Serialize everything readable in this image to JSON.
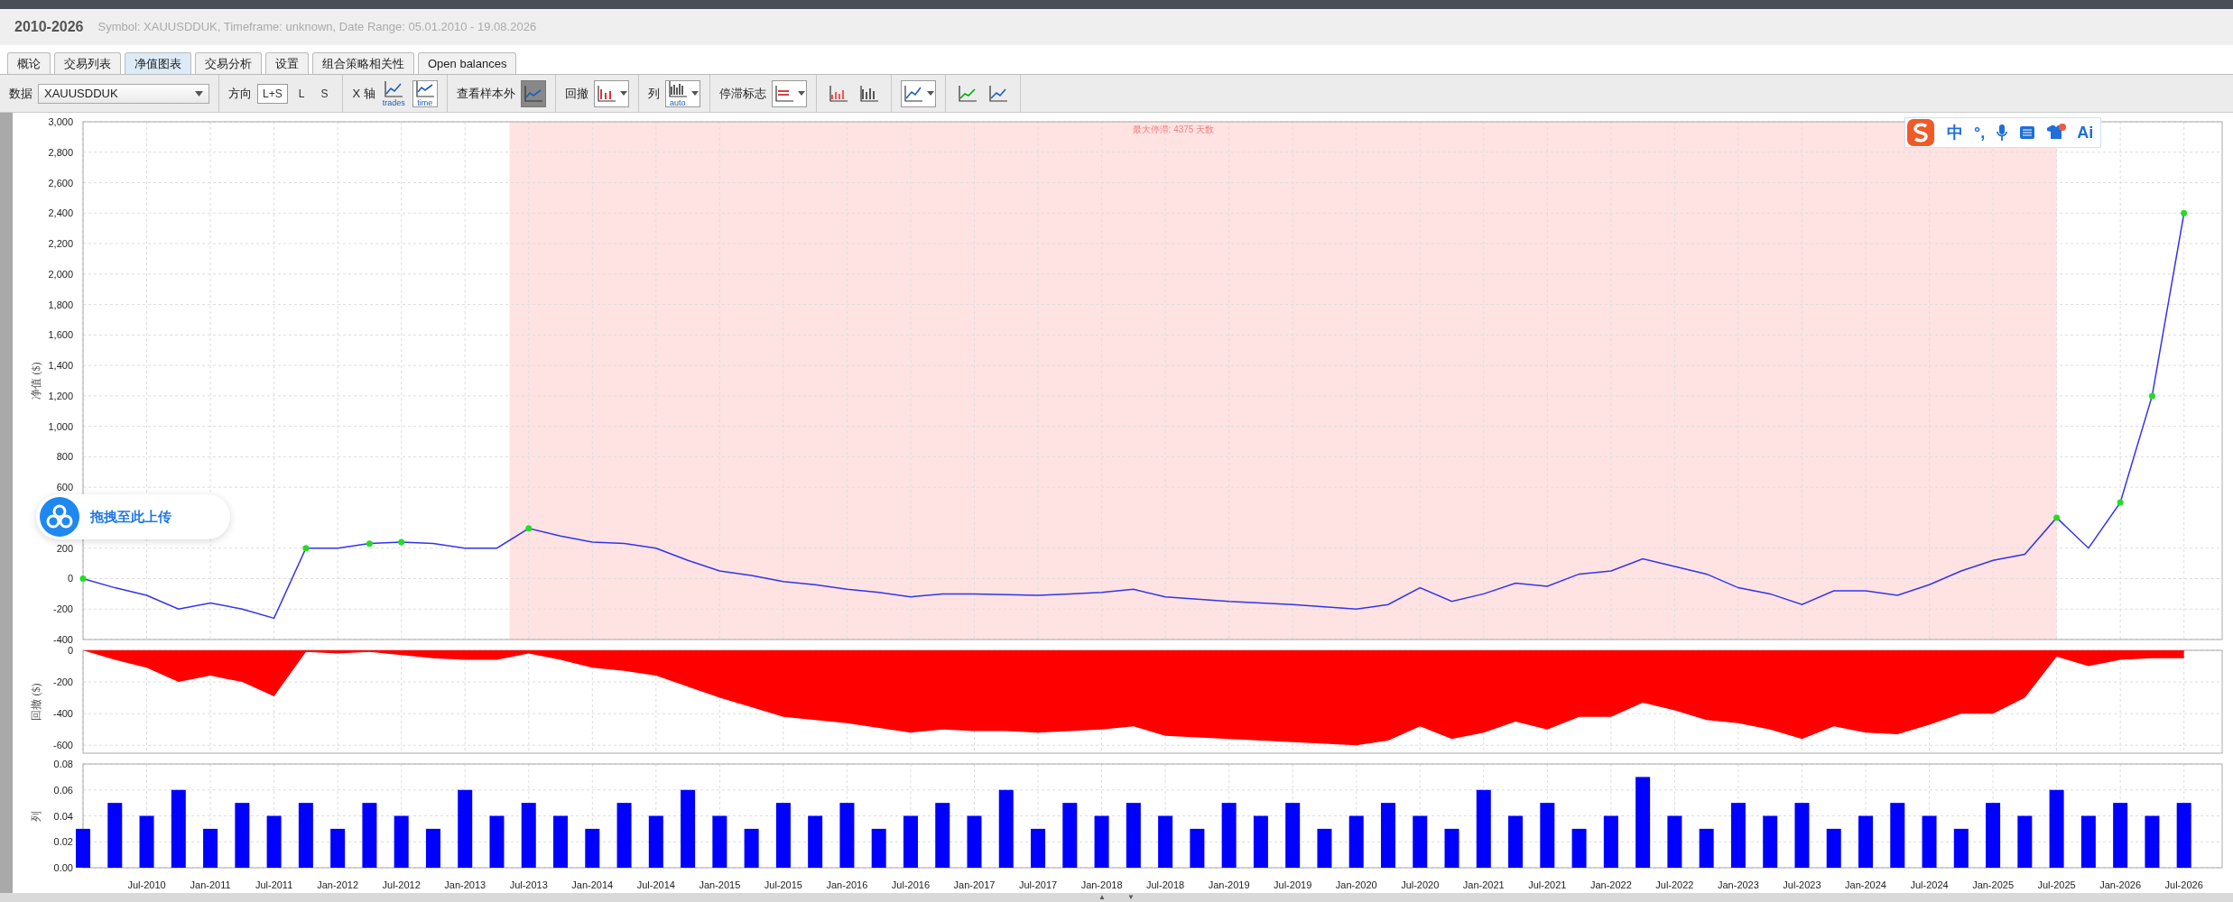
{
  "header": {
    "title": "2010-2026",
    "subtitle": "Symbol: XAUUSDDUK, Timeframe: unknown, Date Range: 05.01.2010 - 19.08.2026"
  },
  "tabs": [
    {
      "label": "概论",
      "selected": false
    },
    {
      "label": "交易列表",
      "selected": false
    },
    {
      "label": "净值图表",
      "selected": true
    },
    {
      "label": "交易分析",
      "selected": false
    },
    {
      "label": "设置",
      "selected": false
    },
    {
      "label": "组合策略相关性",
      "selected": false
    },
    {
      "label": "Open balances",
      "selected": false
    }
  ],
  "toolbar_groups": [
    [
      {
        "kind": "label",
        "text": "数据"
      },
      {
        "kind": "select",
        "value": "XAUUSDDUK"
      }
    ],
    [
      {
        "kind": "label",
        "text": "方向"
      },
      {
        "kind": "toggle",
        "text": "L+S",
        "selected": true
      },
      {
        "kind": "toggle",
        "text": "L",
        "selected": false
      },
      {
        "kind": "toggle",
        "text": "S",
        "selected": false
      }
    ],
    [
      {
        "kind": "label",
        "text": "X 轴"
      },
      {
        "kind": "icon",
        "caption": "trades",
        "selected": false,
        "disabled": false,
        "dropdown": false
      },
      {
        "kind": "icon",
        "caption": "time",
        "selected": true,
        "disabled": false,
        "dropdown": false
      }
    ],
    [
      {
        "kind": "label",
        "text": "查看样本外"
      },
      {
        "kind": "icon",
        "selected": false,
        "disabled": true,
        "dropdown": false
      }
    ],
    [
      {
        "kind": "label",
        "text": "回撤"
      },
      {
        "kind": "icon",
        "selected": true,
        "disabled": false,
        "dropdown": true
      }
    ],
    [
      {
        "kind": "label",
        "text": "列"
      },
      {
        "kind": "icon",
        "caption": "auto",
        "selected": true,
        "disabled": false,
        "dropdown": true
      }
    ],
    [
      {
        "kind": "label",
        "text": "停滞标志"
      },
      {
        "kind": "icon",
        "selected": true,
        "disabled": false,
        "dropdown": true
      }
    ],
    [
      {
        "kind": "icon",
        "selected": false,
        "disabled": false,
        "dropdown": false
      },
      {
        "kind": "icon",
        "selected": false,
        "disabled": false,
        "dropdown": false
      }
    ],
    [
      {
        "kind": "icon",
        "selected": true,
        "disabled": false,
        "dropdown": true
      }
    ],
    [
      {
        "kind": "icon",
        "selected": false,
        "disabled": false,
        "dropdown": false
      },
      {
        "kind": "icon",
        "selected": false,
        "disabled": false,
        "dropdown": false
      }
    ]
  ],
  "equity_chart": {
    "chart_data": {
      "type": "line",
      "ylabel": "净值 ($)",
      "ylim": [
        -400,
        3000
      ],
      "yticks": [
        {
          "value": -400,
          "label": "-400"
        },
        {
          "value": -200,
          "label": "-200"
        },
        {
          "value": 0,
          "label": "0"
        },
        {
          "value": 200,
          "label": "200"
        },
        {
          "value": 600,
          "label": "600"
        },
        {
          "value": 800,
          "label": "800"
        },
        {
          "value": 1000,
          "label": "1,000"
        },
        {
          "value": 1200,
          "label": "1,200"
        },
        {
          "value": 1400,
          "label": "1,400"
        },
        {
          "value": 1600,
          "label": "1,600"
        },
        {
          "value": 1800,
          "label": "1,800"
        },
        {
          "value": 2000,
          "label": "2,000"
        },
        {
          "value": 2200,
          "label": "2,200"
        },
        {
          "value": 2400,
          "label": "2,400"
        },
        {
          "value": 2600,
          "label": "2,600"
        },
        {
          "value": 2800,
          "label": "2,800"
        },
        {
          "value": 3000,
          "label": "3,000"
        }
      ],
      "categories": [
        null,
        null,
        null,
        null,
        null,
        null,
        null,
        null,
        null,
        null,
        null,
        null,
        null,
        null,
        null,
        null,
        null,
        null,
        null,
        null,
        null,
        null,
        null,
        null,
        null,
        null,
        null,
        null,
        null,
        null,
        null,
        null,
        null,
        null,
        null,
        null,
        null,
        null,
        null,
        null,
        null,
        null,
        null,
        null,
        null,
        null,
        null,
        null,
        null,
        null,
        null,
        null,
        null,
        null,
        null,
        null,
        null,
        null,
        null,
        null,
        null,
        null,
        null,
        null,
        null,
        null,
        null
      ],
      "series": [
        {
          "color": "#3333ee",
          "values": [
            0,
            -60,
            -110,
            -200,
            -160,
            -200,
            -260,
            200,
            200,
            230,
            240,
            230,
            200,
            200,
            330,
            280,
            240,
            230,
            200,
            120,
            50,
            20,
            -20,
            -40,
            -70,
            -90,
            -120,
            -100,
            -100,
            -105,
            -110,
            -100,
            -90,
            -70,
            -120,
            -135,
            -150,
            -160,
            -170,
            -185,
            -200,
            -170,
            -60,
            -150,
            -100,
            -30,
            -50,
            30,
            50,
            130,
            80,
            30,
            -60,
            -100,
            -170,
            -80,
            -80,
            -110,
            -40,
            50,
            120,
            160,
            400,
            200,
            500,
            1200,
            2400
          ]
        }
      ],
      "grid": true
    },
    "stagnation_band": {
      "label": "最大停滞: 4375 天数"
    }
  },
  "drawdown_chart": {
    "chart_data": {
      "type": "area",
      "ylabel": "回撤 ($)",
      "ylim": [
        -650,
        0
      ],
      "yticks": [
        {
          "value": 0,
          "label": "0"
        },
        {
          "value": -200,
          "label": "-200"
        },
        {
          "value": -400,
          "label": "-400"
        },
        {
          "value": -600,
          "label": "-600"
        }
      ],
      "categories": [
        null,
        null,
        null,
        null,
        null,
        null,
        null,
        null,
        null,
        null,
        null,
        null,
        null,
        null,
        null,
        null,
        null,
        null,
        null,
        null,
        null,
        null,
        null,
        null,
        null,
        null,
        null,
        null,
        null,
        null,
        null,
        null,
        null,
        null,
        null,
        null,
        null,
        null,
        null,
        null,
        null,
        null,
        null,
        null,
        null,
        null,
        null,
        null,
        null,
        null,
        null,
        null,
        null,
        null,
        null,
        null,
        null,
        null,
        null,
        null,
        null,
        null,
        null,
        null,
        null,
        null,
        null
      ],
      "grid": true,
      "series": [
        {
          "color": "#ff0000",
          "values": [
            0,
            -60,
            -110,
            -200,
            -160,
            -200,
            -290,
            -10,
            -20,
            -10,
            -30,
            -50,
            -60,
            -60,
            -20,
            -60,
            -110,
            -130,
            -160,
            -230,
            -300,
            -360,
            -420,
            -440,
            -460,
            -490,
            -520,
            -500,
            -510,
            -510,
            -520,
            -510,
            -500,
            -480,
            -540,
            -550,
            -560,
            -570,
            -580,
            -590,
            -600,
            -570,
            -480,
            -560,
            -520,
            -450,
            -500,
            -420,
            -420,
            -330,
            -380,
            -440,
            -460,
            -500,
            -560,
            -480,
            -520,
            -530,
            -470,
            -400,
            -400,
            -300,
            -40,
            -100,
            -60,
            -50,
            -50
          ]
        }
      ]
    }
  },
  "lots_chart": {
    "chart_data": {
      "type": "bar",
      "ylabel": "列",
      "ylim": [
        0,
        0.08
      ],
      "grid": true,
      "categories": [
        null,
        null,
        "Jul-2010",
        null,
        "Jan-2011",
        null,
        "Jul-2011",
        null,
        "Jan-2012",
        null,
        "Jul-2012",
        null,
        "Jan-2013",
        null,
        "Jul-2013",
        null,
        "Jan-2014",
        null,
        "Jul-2014",
        null,
        "Jan-2015",
        null,
        "Jul-2015",
        null,
        "Jan-2016",
        null,
        "Jul-2016",
        null,
        "Jan-2017",
        null,
        "Jul-2017",
        null,
        "Jan-2018",
        null,
        "Jul-2018",
        null,
        "Jan-2019",
        null,
        "Jul-2019",
        null,
        "Jan-2020",
        null,
        "Jul-2020",
        null,
        "Jan-2021",
        null,
        "Jul-2021",
        null,
        "Jan-2022",
        null,
        "Jul-2022",
        null,
        "Jan-2023",
        null,
        "Jul-2023",
        null,
        "Jan-2024",
        null,
        "Jul-2024",
        null,
        "Jan-2025",
        null,
        "Jul-2025",
        null,
        "Jan-2026",
        null,
        "Jul-2026"
      ],
      "yticks": [
        {
          "value": 0,
          "label": "0.00"
        },
        {
          "value": 0.02,
          "label": "0.02"
        },
        {
          "value": 0.04,
          "label": "0.04"
        },
        {
          "value": 0.06,
          "label": "0.06"
        },
        {
          "value": 0.08,
          "label": "0.08"
        }
      ],
      "series": [
        {
          "color": "#0000ff",
          "values": [
            0.03,
            0.05,
            0.04,
            0.06,
            0.03,
            0.05,
            0.04,
            0.05,
            0.03,
            0.05,
            0.04,
            0.03,
            0.06,
            0.04,
            0.05,
            0.04,
            0.03,
            0.05,
            0.04,
            0.06,
            0.04,
            0.03,
            0.05,
            0.04,
            0.05,
            0.03,
            0.04,
            0.05,
            0.04,
            0.06,
            0.03,
            0.05,
            0.04,
            0.05,
            0.04,
            0.03,
            0.05,
            0.04,
            0.05,
            0.03,
            0.04,
            0.05,
            0.04,
            0.03,
            0.06,
            0.04,
            0.05,
            0.03,
            0.04,
            0.07,
            0.04,
            0.03,
            0.05,
            0.04,
            0.05,
            0.03,
            0.04,
            0.05,
            0.04,
            0.03,
            0.05,
            0.04,
            0.06,
            0.04,
            0.05,
            0.04,
            0.05
          ]
        }
      ]
    }
  },
  "overlays": {
    "ime_toolbar": {
      "items": [
        "中",
        "°,",
        "Ai"
      ]
    },
    "upload_widget": {
      "text": "拖拽至此上传"
    }
  },
  "splitter": {
    "arrows": [
      "▲",
      "▼"
    ]
  }
}
